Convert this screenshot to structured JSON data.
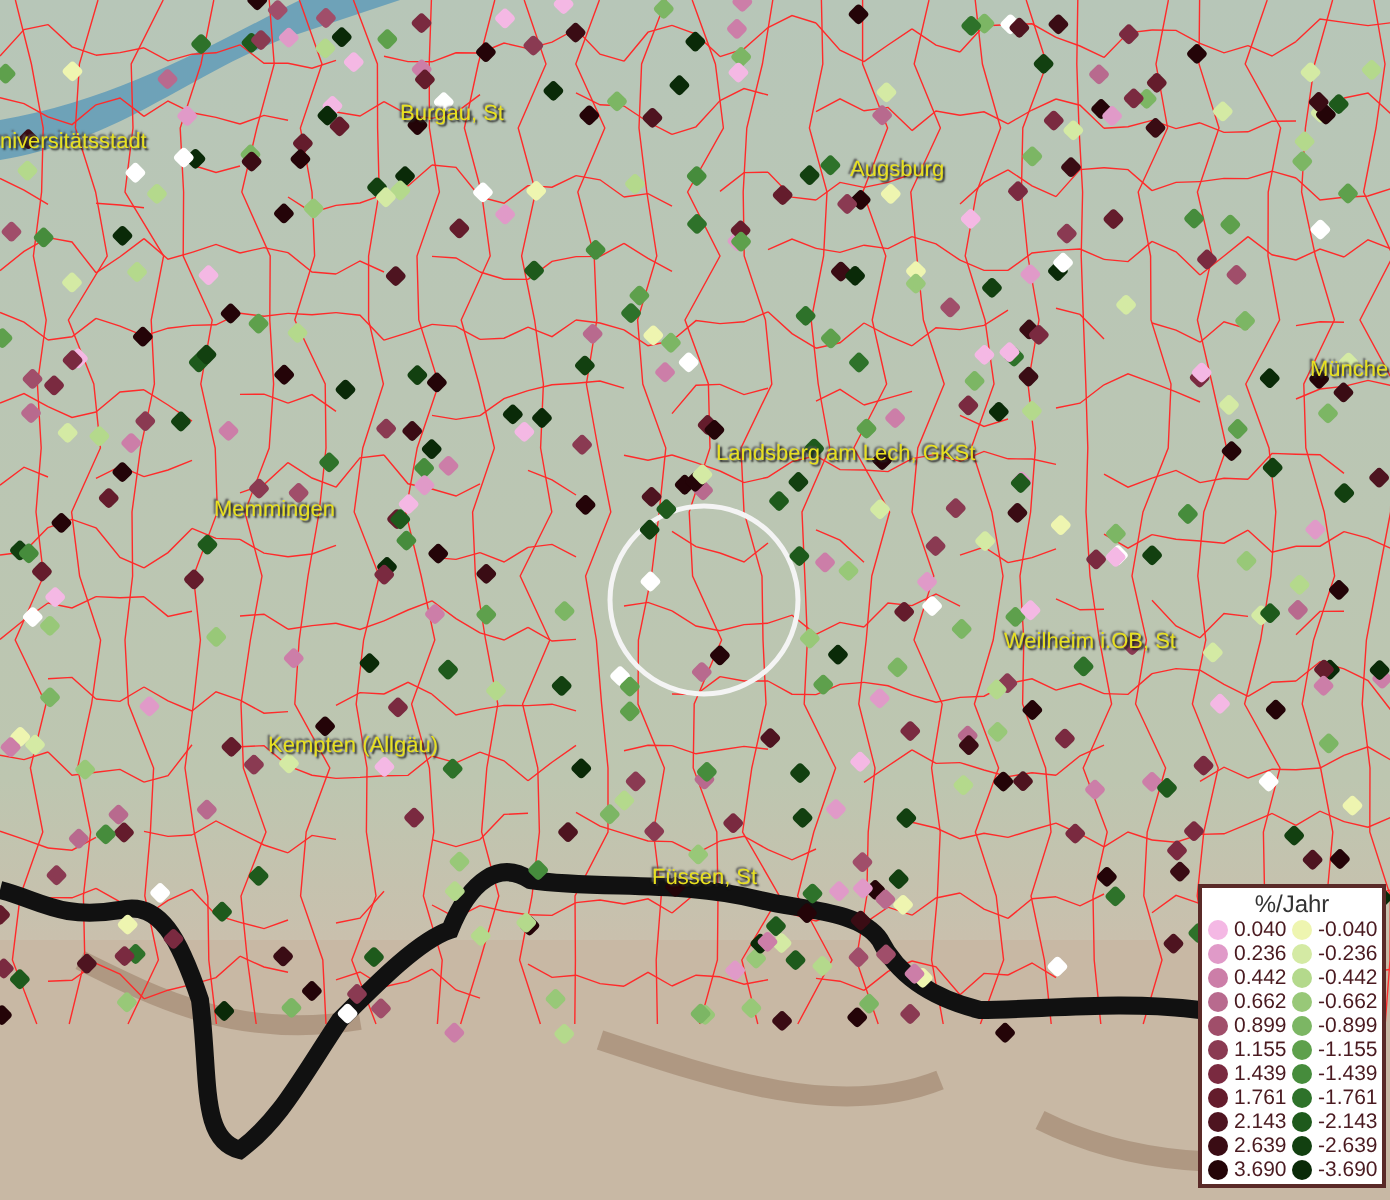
{
  "map": {
    "places": [
      {
        "name": "niversitätsstadt"
      },
      {
        "name": "Burgau, St"
      },
      {
        "name": "Augsburg"
      },
      {
        "name": "Münche"
      },
      {
        "name": "Landsberg am Lech, GKSt"
      },
      {
        "name": "Memmingen"
      },
      {
        "name": "Weilheim i.OB, St"
      },
      {
        "name": "Kempten (Allgäu)"
      },
      {
        "name": "Füssen, St"
      }
    ]
  },
  "legend": {
    "title": "%/Jahr",
    "items": [
      {
        "label": "0.040",
        "color": "#f4b8e4"
      },
      {
        "label": "-0.040",
        "color": "#eef5b0"
      },
      {
        "label": "0.236",
        "color": "#e09ac8"
      },
      {
        "label": "-0.236",
        "color": "#d4eaa4"
      },
      {
        "label": "0.442",
        "color": "#cc7ea8"
      },
      {
        "label": "-0.442",
        "color": "#b4d98c"
      },
      {
        "label": "0.662",
        "color": "#b86a8e"
      },
      {
        "label": "-0.662",
        "color": "#98c878"
      },
      {
        "label": "0.899",
        "color": "#a04e6a"
      },
      {
        "label": "-0.899",
        "color": "#7cb664"
      },
      {
        "label": "1.155",
        "color": "#8a3a52"
      },
      {
        "label": "-1.155",
        "color": "#5ea04c"
      },
      {
        "label": "1.439",
        "color": "#7a2a40"
      },
      {
        "label": "-1.439",
        "color": "#468c3c"
      },
      {
        "label": "1.761",
        "color": "#641c2c"
      },
      {
        "label": "-1.761",
        "color": "#2e722a"
      },
      {
        "label": "2.143",
        "color": "#4e1420"
      },
      {
        "label": "-2.143",
        "color": "#1e5a1c"
      },
      {
        "label": "2.639",
        "color": "#3a0c14"
      },
      {
        "label": "-2.639",
        "color": "#124010"
      },
      {
        "label": "3.690",
        "color": "#240408"
      },
      {
        "label": "-3.690",
        "color": "#0a2a08"
      }
    ]
  }
}
